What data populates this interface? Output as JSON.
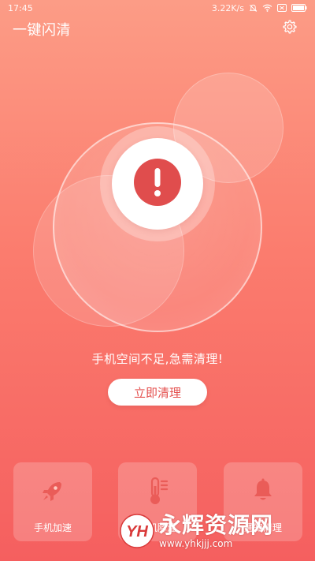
{
  "status_bar": {
    "time": "17:45",
    "speed": "3.22K/s",
    "icons": [
      "bell-off-icon",
      "wifi-icon",
      "sim-icon",
      "battery-icon"
    ]
  },
  "header": {
    "title": "一键闪清",
    "settings_icon": "gear-icon"
  },
  "alert": {
    "icon": "exclamation-icon",
    "accent_color": "#e04d4d"
  },
  "message": "手机空间不足,急需清理!",
  "clean_button_label": "立即清理",
  "cards": [
    {
      "label": "手机加速",
      "icon": "rocket-icon"
    },
    {
      "label": "手机降温",
      "icon": "thermometer-icon"
    },
    {
      "label": "通知清理",
      "icon": "bell-icon"
    }
  ],
  "watermark": {
    "logo_text": "YH",
    "name": "永辉资源网",
    "url": "www.yhkjjj.com"
  },
  "colors": {
    "background_top": "#fc9c86",
    "background_bottom": "#f55f5f",
    "button_text": "#e4504e"
  }
}
